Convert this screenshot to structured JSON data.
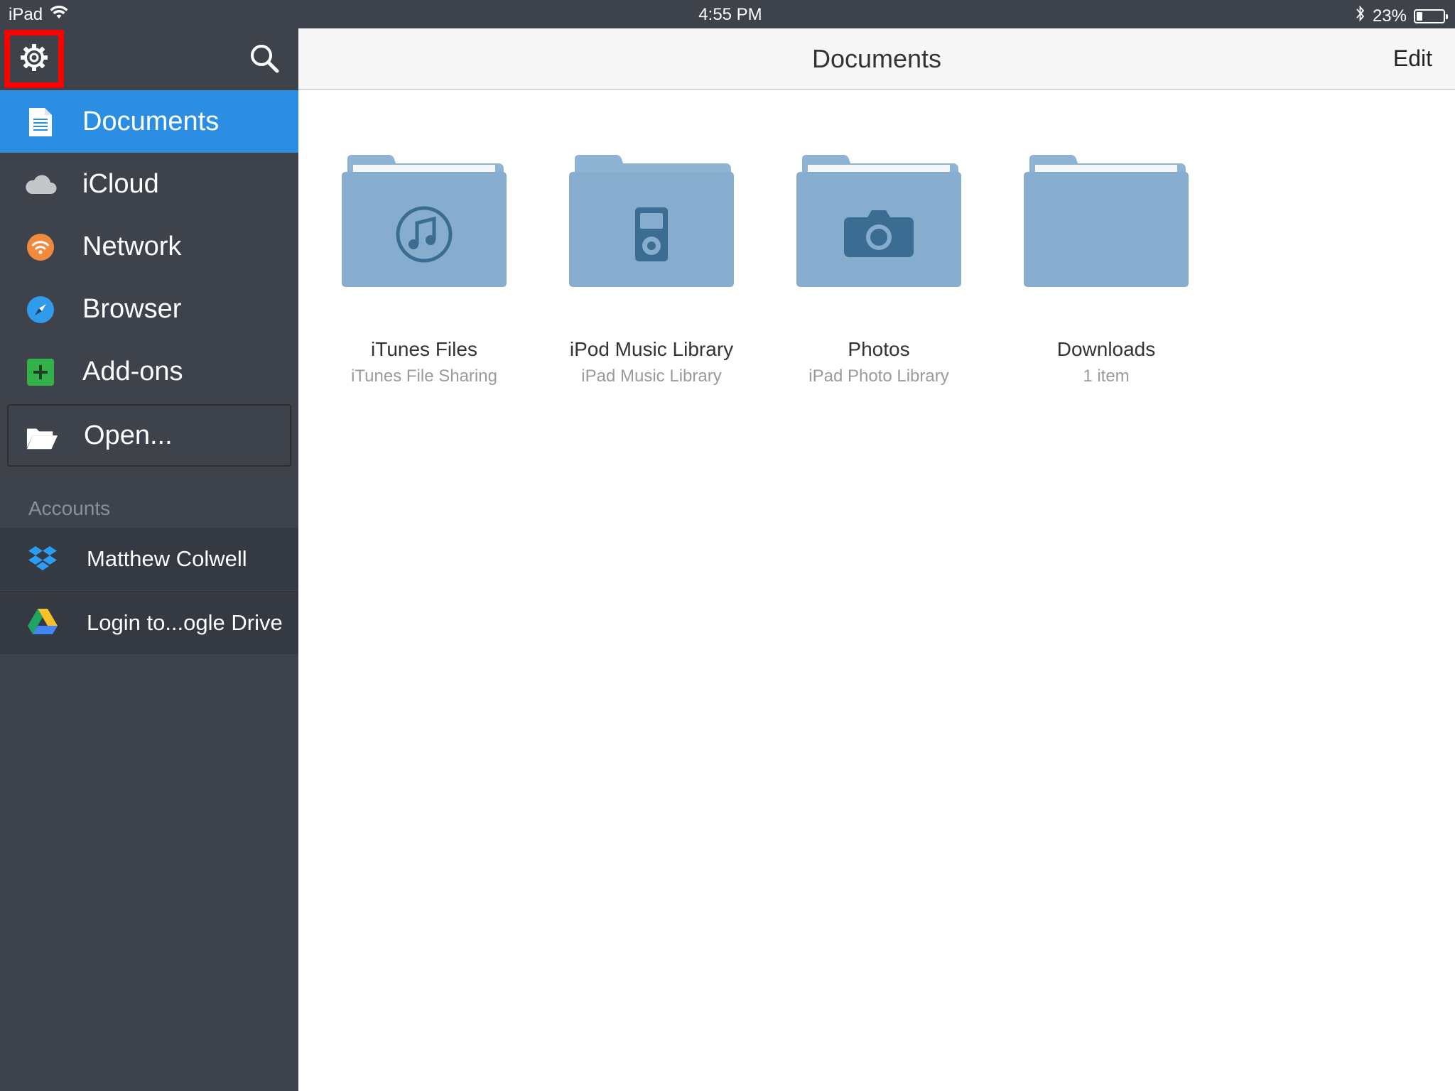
{
  "status_bar": {
    "device": "iPad",
    "time": "4:55 PM",
    "battery_percent": "23%",
    "battery_level": 0.23,
    "icons": [
      "wifi-icon",
      "bluetooth-icon",
      "battery-icon"
    ]
  },
  "sidebar": {
    "toolbar": {
      "settings_icon": "gear-icon",
      "search_icon": "search-icon"
    },
    "items": [
      {
        "label": "Documents",
        "icon": "document-icon",
        "active": true
      },
      {
        "label": "iCloud",
        "icon": "cloud-icon"
      },
      {
        "label": "Network",
        "icon": "network-icon"
      },
      {
        "label": "Browser",
        "icon": "compass-icon"
      },
      {
        "label": "Add-ons",
        "icon": "plus-icon"
      },
      {
        "label": "Open...",
        "icon": "folder-open-icon"
      }
    ],
    "accounts_header": "Accounts",
    "accounts": [
      {
        "label": "Matthew Colwell",
        "icon": "dropbox-icon"
      },
      {
        "label": "Login to...ogle Drive",
        "icon": "google-drive-icon"
      }
    ]
  },
  "main": {
    "title": "Documents",
    "edit_label": "Edit",
    "folders": [
      {
        "name": "iTunes Files",
        "subtitle": "iTunes File Sharing",
        "icon": "music-note-icon"
      },
      {
        "name": "iPod Music Library",
        "subtitle": "iPad Music Library",
        "icon": "ipod-icon"
      },
      {
        "name": "Photos",
        "subtitle": "iPad Photo Library",
        "icon": "camera-icon"
      },
      {
        "name": "Downloads",
        "subtitle": "1 item",
        "icon": ""
      }
    ]
  },
  "colors": {
    "sidebar_bg": "#3e424b",
    "active_bg": "#2b8ee3",
    "folder_body": "#86acce",
    "folder_glyph": "#3b6d93",
    "highlight_border": "#ff0000"
  }
}
